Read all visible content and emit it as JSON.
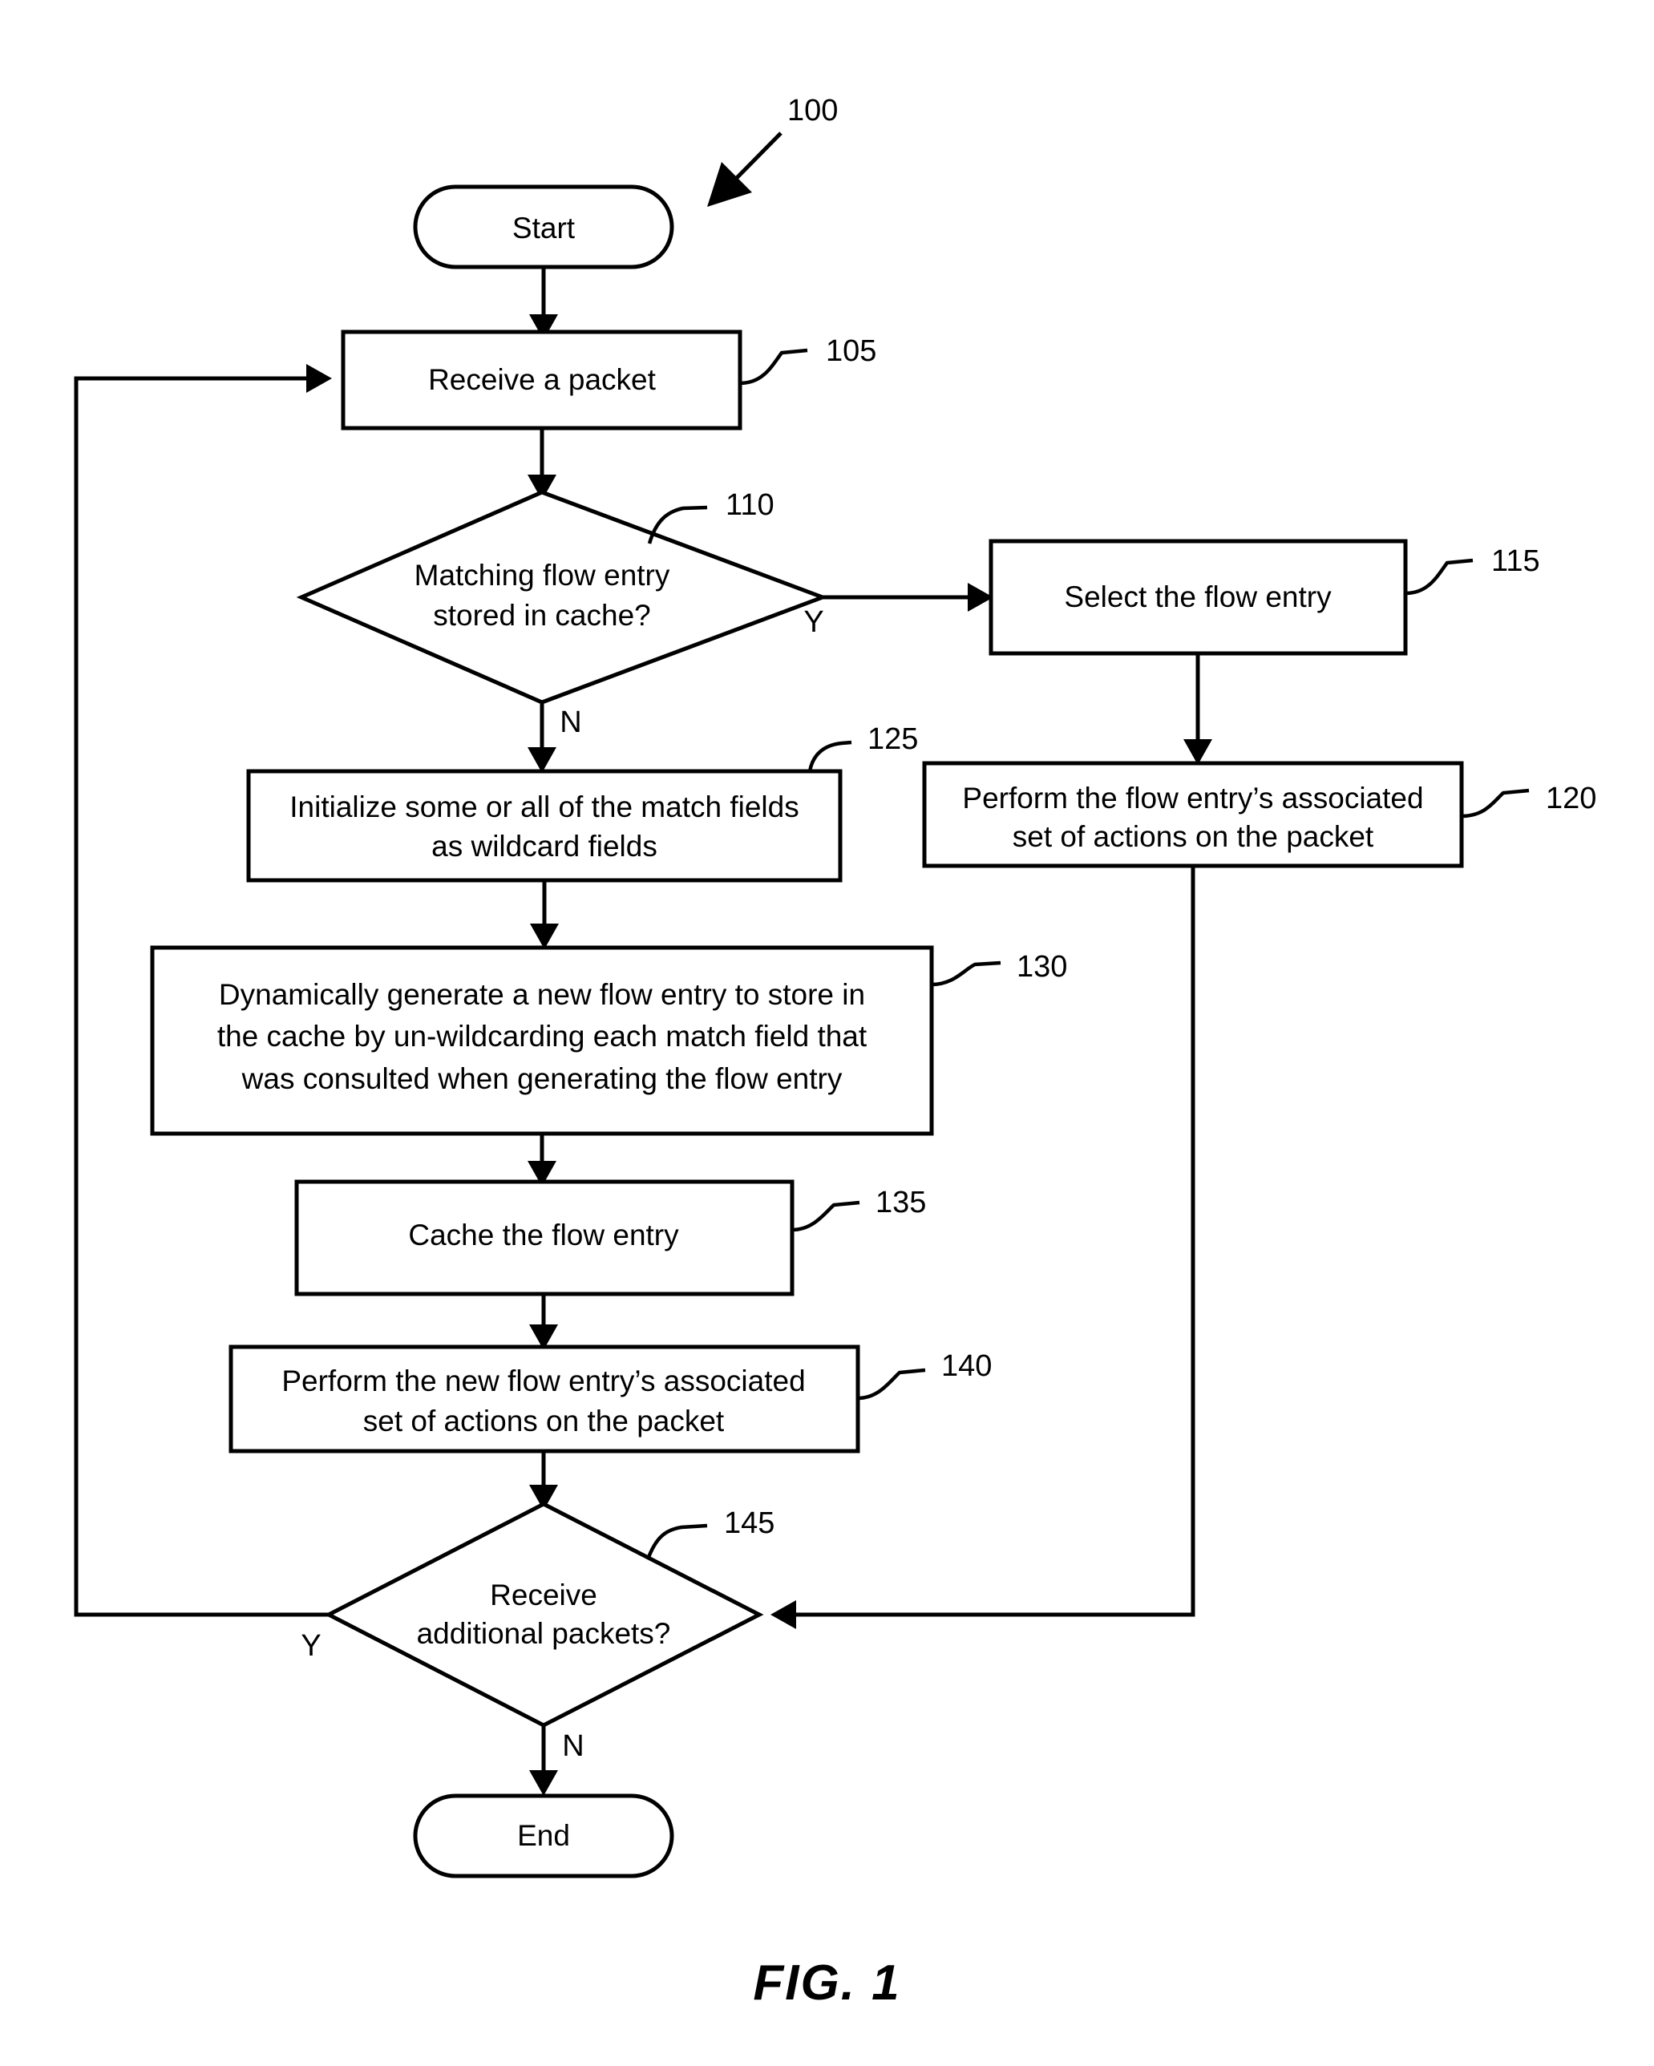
{
  "figure": {
    "caption": "FIG. 1",
    "reference_numeral": "100"
  },
  "nodes": [
    {
      "id": "start",
      "type": "terminator",
      "label": "Start",
      "ref": ""
    },
    {
      "id": "n105",
      "type": "process",
      "label": "Receive a packet",
      "ref": "105"
    },
    {
      "id": "n110",
      "type": "decision",
      "line1": "Matching flow entry",
      "line2": "stored in cache?",
      "ref": "110"
    },
    {
      "id": "n115",
      "type": "process",
      "label": "Select the flow entry",
      "ref": "115"
    },
    {
      "id": "n120",
      "type": "process",
      "line1": "Perform the flow entry’s associated",
      "line2": "set of actions on the packet",
      "ref": "120"
    },
    {
      "id": "n125",
      "type": "process",
      "line1": "Initialize some or all of the match fields",
      "line2": "as wildcard fields",
      "ref": "125"
    },
    {
      "id": "n130",
      "type": "process",
      "line1": "Dynamically generate a new flow entry to store in",
      "line2": "the cache by un-wildcarding each match field that",
      "line3": "was consulted when generating the flow entry",
      "ref": "130"
    },
    {
      "id": "n135",
      "type": "process",
      "label": "Cache the flow entry",
      "ref": "135"
    },
    {
      "id": "n140",
      "type": "process",
      "line1": "Perform the new flow entry’s associated",
      "line2": "set of actions on the packet",
      "ref": "140"
    },
    {
      "id": "n145",
      "type": "decision",
      "line1": "Receive",
      "line2": "additional packets?",
      "ref": "145"
    },
    {
      "id": "end",
      "type": "terminator",
      "label": "End",
      "ref": ""
    }
  ],
  "branch_labels": {
    "d110_yes": "Y",
    "d110_no": "N",
    "d145_yes": "Y",
    "d145_no": "N"
  },
  "colors": {
    "stroke": "#000000",
    "fill": "#ffffff",
    "text": "#000000"
  }
}
